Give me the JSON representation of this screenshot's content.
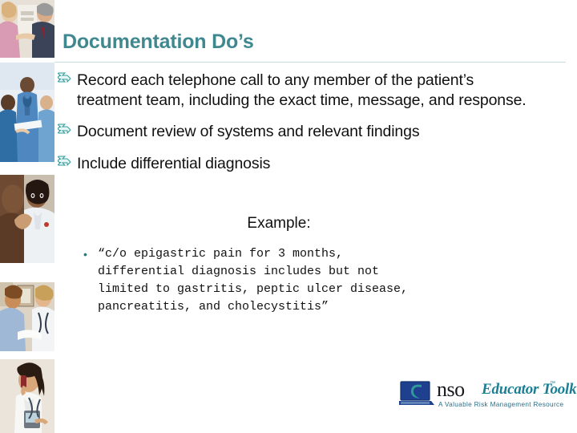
{
  "slide": {
    "title": "Documentation Do’s",
    "title_color": "#3f888f",
    "divider_color": "#c5dee2",
    "background_color": "#ffffff"
  },
  "bullets": {
    "glyph": "➡",
    "glyph_name": "teal-arrow-bullet-icon",
    "glyph_color": "#2f9a9a",
    "items": [
      {
        "text": "Record each telephone call to any member of the patient’s treatment team, including the exact time, message, and response."
      },
      {
        "text": "Document review of systems and relevant findings"
      },
      {
        "text": "Include differential diagnosis"
      }
    ]
  },
  "example": {
    "heading": "Example:",
    "dot": "•",
    "dot_color": "#1f7d80",
    "quote": "“c/o epigastric pain for 3 months,\ndifferential diagnosis includes but not\nlimited to gastritis, peptic ulcer disease,\npancreatitis, and cholecystitis”"
  },
  "logo": {
    "brand": "nso",
    "product": "Educator Toolkit",
    "trademark": "™",
    "tagline": "A Valuable Risk Management Resource",
    "brand_color": "#17171c",
    "product_color": "#1b7f93",
    "screen_color": "#1f3f8f",
    "swoosh_color": "#2f9a9a"
  },
  "photo_strip": {
    "items": [
      {
        "name": "photo-nurse-with-elderly-patient"
      },
      {
        "name": "photo-clinical-team-in-scrubs"
      },
      {
        "name": "photo-nurse-speaking-with-patient"
      },
      {
        "name": "photo-two-clinicians-seated"
      },
      {
        "name": "photo-nurse-on-telephone"
      }
    ]
  }
}
